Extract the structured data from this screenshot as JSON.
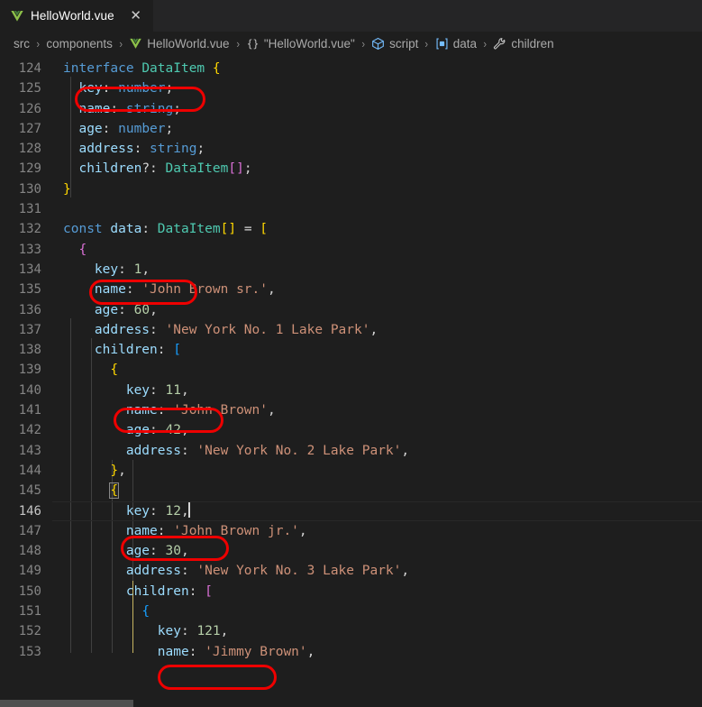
{
  "window": {
    "theme_bg": "#1e1e1e",
    "accent_annotation_color": "#ee0000"
  },
  "tab": {
    "label": "HelloWorld.vue",
    "icon": "vue-file-icon",
    "close_label": "✕",
    "dirty": false
  },
  "breadcrumb": {
    "separator": "›",
    "items": [
      {
        "label": "src",
        "icon": "none"
      },
      {
        "label": "components",
        "icon": "none"
      },
      {
        "label": "HelloWorld.vue",
        "icon": "vue-file-icon"
      },
      {
        "label": "\"HelloWorld.vue\"",
        "icon": "braces-icon"
      },
      {
        "label": "script",
        "icon": "module-cube-icon"
      },
      {
        "label": "data",
        "icon": "variable-box-icon"
      },
      {
        "label": "children",
        "icon": "wrench-field-icon"
      }
    ]
  },
  "editor": {
    "language": "typescript",
    "active_line": 146,
    "first_visible_line": 124,
    "last_visible_line": 153,
    "cursor": {
      "line": 146,
      "after_text": "key: 12,"
    },
    "syntax_colors": {
      "keyword": "#569cd6",
      "type": "#4ec9b0",
      "property": "#9cdcfe",
      "string": "#ce9178",
      "number": "#b5cea8",
      "punctuation": "#d4d4d4",
      "bracket_level_1": "#ffd700",
      "bracket_level_2": "#da70d6",
      "bracket_level_3": "#179fff",
      "line_number": "#858585",
      "line_number_active": "#c6c6c6"
    },
    "lines": [
      {
        "n": 124,
        "text": "interface DataItem {"
      },
      {
        "n": 125,
        "text": "  key: number;"
      },
      {
        "n": 126,
        "text": "  name: string;"
      },
      {
        "n": 127,
        "text": "  age: number;"
      },
      {
        "n": 128,
        "text": "  address: string;"
      },
      {
        "n": 129,
        "text": "  children?: DataItem[];"
      },
      {
        "n": 130,
        "text": "}"
      },
      {
        "n": 131,
        "text": ""
      },
      {
        "n": 132,
        "text": "const data: DataItem[] = ["
      },
      {
        "n": 133,
        "text": "  {"
      },
      {
        "n": 134,
        "text": "    key: 1,"
      },
      {
        "n": 135,
        "text": "    name: 'John Brown sr.',"
      },
      {
        "n": 136,
        "text": "    age: 60,"
      },
      {
        "n": 137,
        "text": "    address: 'New York No. 1 Lake Park',"
      },
      {
        "n": 138,
        "text": "    children: ["
      },
      {
        "n": 139,
        "text": "      {"
      },
      {
        "n": 140,
        "text": "        key: 11,"
      },
      {
        "n": 141,
        "text": "        name: 'John Brown',"
      },
      {
        "n": 142,
        "text": "        age: 42,"
      },
      {
        "n": 143,
        "text": "        address: 'New York No. 2 Lake Park',"
      },
      {
        "n": 144,
        "text": "      },"
      },
      {
        "n": 145,
        "text": "      {"
      },
      {
        "n": 146,
        "text": "        key: 12,"
      },
      {
        "n": 147,
        "text": "        name: 'John Brown jr.',"
      },
      {
        "n": 148,
        "text": "        age: 30,"
      },
      {
        "n": 149,
        "text": "        address: 'New York No. 3 Lake Park',"
      },
      {
        "n": 150,
        "text": "        children: ["
      },
      {
        "n": 151,
        "text": "          {"
      },
      {
        "n": 152,
        "text": "            key: 121,"
      },
      {
        "n": 153,
        "text": "            name: 'Jimmy Brown',"
      }
    ]
  },
  "annotations": [
    {
      "target_line": 125,
      "text": "key: number;"
    },
    {
      "target_line": 134,
      "text": "key: 1,"
    },
    {
      "target_line": 140,
      "text": "key: 11,"
    },
    {
      "target_line": 146,
      "text": "key: 12,"
    },
    {
      "target_line": 152,
      "text": "key: 121,"
    }
  ]
}
